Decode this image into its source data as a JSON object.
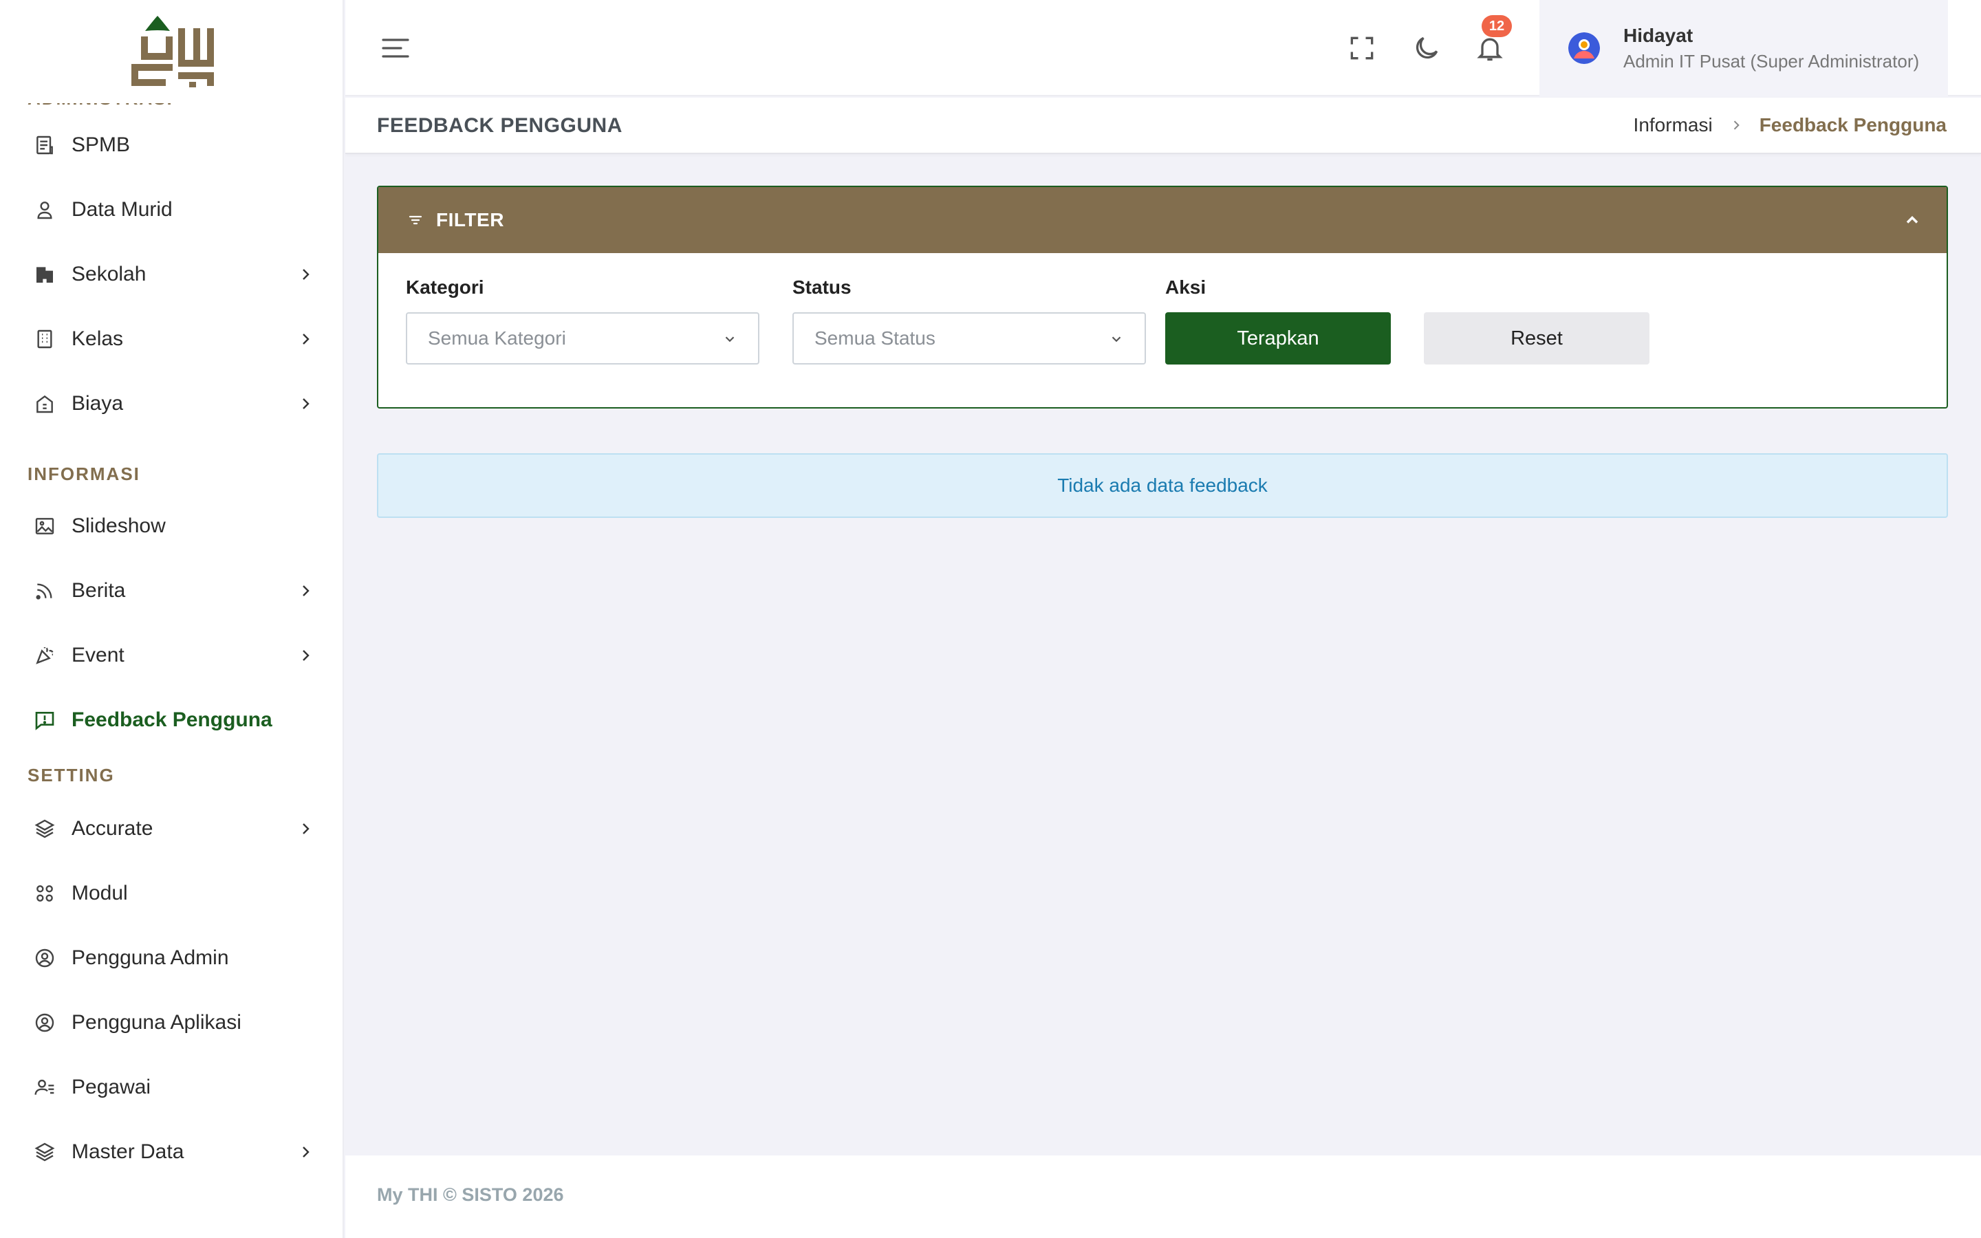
{
  "sidebar": {
    "logo_alt": "logo",
    "sections": {
      "administrasi": "ADMINISTRASI",
      "informasi": "INFORMASI",
      "setting": "SETTING"
    },
    "items": {
      "spmb": "SPMB",
      "data_murid": "Data Murid",
      "sekolah": "Sekolah",
      "kelas": "Kelas",
      "biaya": "Biaya",
      "slideshow": "Slideshow",
      "berita": "Berita",
      "event": "Event",
      "feedback": "Feedback Pengguna",
      "accurate": "Accurate",
      "modul": "Modul",
      "pengguna_admin": "Pengguna Admin",
      "pengguna_aplikasi": "Pengguna Aplikasi",
      "pegawai": "Pegawai",
      "master_data": "Master Data"
    }
  },
  "header": {
    "notification_count": "12",
    "user_name": "Hidayat",
    "user_role": "Admin IT Pusat (Super Administrator)"
  },
  "page": {
    "title": "FEEDBACK PENGGUNA",
    "breadcrumb_parent": "Informasi",
    "breadcrumb_current": "Feedback Pengguna"
  },
  "filter": {
    "title": "FILTER",
    "kategori_label": "Kategori",
    "kategori_value": "Semua Kategori",
    "status_label": "Status",
    "status_value": "Semua Status",
    "aksi_label": "Aksi",
    "apply_label": "Terapkan",
    "reset_label": "Reset"
  },
  "alert": {
    "empty_message": "Tidak ada data feedback"
  },
  "footer": {
    "text": "My THI © SISTO 2026"
  },
  "colors": {
    "brand_brown": "#826e4e",
    "brand_green": "#1b5e20",
    "badge_red": "#f06548",
    "info_text": "#1a7bb0"
  }
}
